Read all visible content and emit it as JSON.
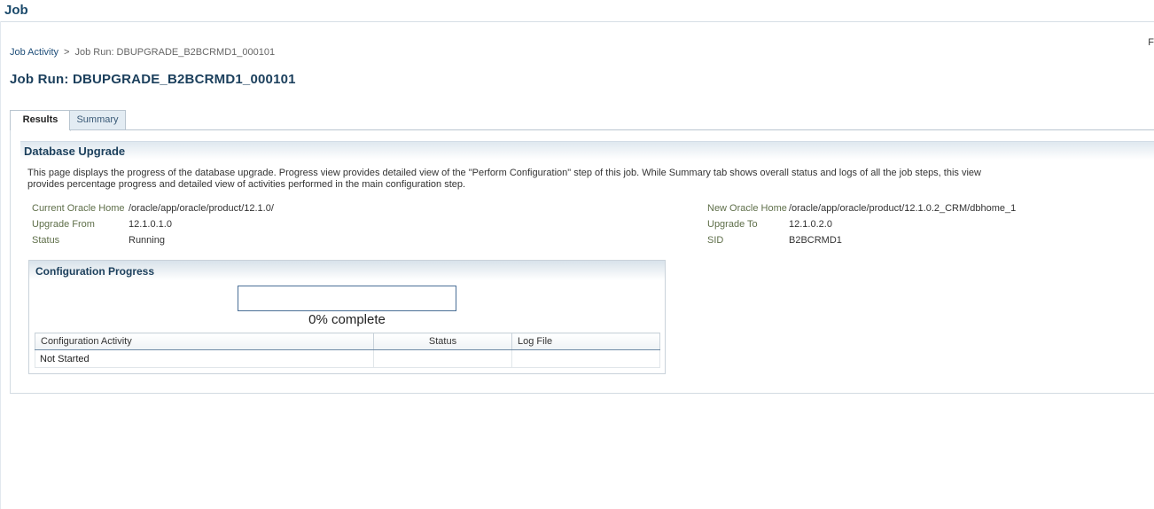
{
  "header": {
    "title": "Job"
  },
  "corner_text": "F",
  "breadcrumb": {
    "link": "Job Activity",
    "separator": ">",
    "current": "Job Run: DBUPGRADE_B2BCRMD1_000101"
  },
  "page_title": "Job Run: DBUPGRADE_B2BCRMD1_000101",
  "tabs": [
    {
      "label": "Results",
      "selected": true
    },
    {
      "label": "Summary",
      "selected": false
    }
  ],
  "section": {
    "title": "Database Upgrade",
    "description": "This page displays the progress of the database upgrade. Progress view provides detailed view of the \"Perform Configuration\" step of this job. While Summary tab shows overall status and logs of all the job steps, this view provides percentage progress and detailed view of activities performed in the main configuration step."
  },
  "info_left": [
    {
      "label": "Current Oracle Home",
      "value": "/oracle/app/oracle/product/12.1.0/"
    },
    {
      "label": "Upgrade From",
      "value": "12.1.0.1.0"
    },
    {
      "label": "Status",
      "value": "Running"
    }
  ],
  "info_right": [
    {
      "label": "New Oracle Home",
      "value": "/oracle/app/oracle/product/12.1.0.2_CRM/dbhome_1"
    },
    {
      "label": "Upgrade To",
      "value": "12.1.0.2.0"
    },
    {
      "label": "SID",
      "value": "B2BCRMD1"
    }
  ],
  "config_progress": {
    "title": "Configuration Progress",
    "progress_percent": 0,
    "progress_text": "0% complete",
    "table": {
      "columns": [
        "Configuration Activity",
        "Status",
        "Log File"
      ],
      "rows": [
        [
          "Not Started",
          "",
          ""
        ]
      ]
    }
  },
  "colors": {
    "heading": "#1b3f5c",
    "link": "#1f4e79",
    "label": "#5f6f4a",
    "progress_border": "#4a6f96"
  }
}
